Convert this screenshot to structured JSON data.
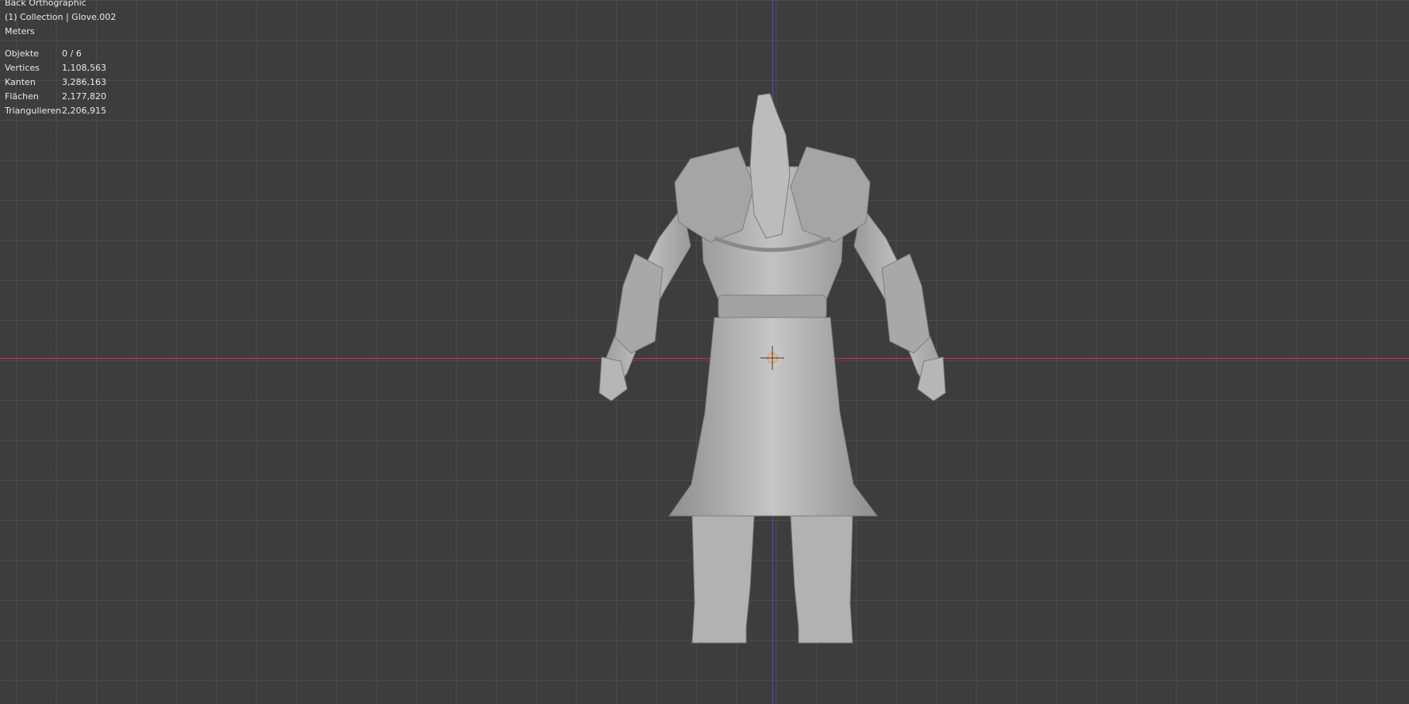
{
  "viewport": {
    "view_name": "Back Orthographic",
    "collection_info": "(1) Collection | Glove.002",
    "units": "Meters",
    "stats": [
      {
        "label": "Objekte",
        "value": "0 / 6"
      },
      {
        "label": "Vertices",
        "value": "1,108,563"
      },
      {
        "label": "Kanten",
        "value": "3,286,163"
      },
      {
        "label": "Flächen",
        "value": "2,177,820"
      },
      {
        "label": "Triangulieren",
        "value": "2,206,915"
      }
    ]
  },
  "colors": {
    "background": "#3d3d3d",
    "grid": "#5a5a5a",
    "x_axis": "#a0464c",
    "y_axis": "#3a5f9a",
    "model": "#b4b4b4"
  }
}
